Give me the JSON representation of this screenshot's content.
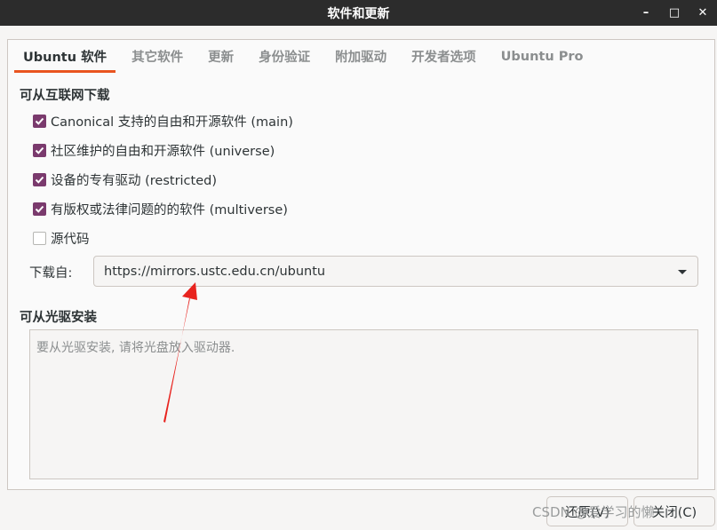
{
  "window": {
    "title": "软件和更新",
    "minimize_glyph": "–",
    "maximize_glyph": "□",
    "close_glyph": "✕"
  },
  "tabs": [
    {
      "label": "Ubuntu 软件",
      "active": true
    },
    {
      "label": "其它软件",
      "active": false
    },
    {
      "label": "更新",
      "active": false
    },
    {
      "label": "身份验证",
      "active": false
    },
    {
      "label": "附加驱动",
      "active": false
    },
    {
      "label": "开发者选项",
      "active": false
    },
    {
      "label": "Ubuntu Pro",
      "active": false
    }
  ],
  "internet": {
    "title": "可从互联网下载",
    "options": [
      {
        "label": "Canonical 支持的自由和开源软件 (main)",
        "checked": true
      },
      {
        "label": "社区维护的自由和开源软件 (universe)",
        "checked": true
      },
      {
        "label": "设备的专有驱动 (restricted)",
        "checked": true
      },
      {
        "label": "有版权或法律问题的的软件 (multiverse)",
        "checked": true
      },
      {
        "label": "源代码",
        "checked": false
      }
    ],
    "download_label": "下载自:",
    "download_server": "https://mirrors.ustc.edu.cn/ubuntu"
  },
  "cdrom": {
    "title": "可从光驱安装",
    "hint": "要从光驱安装, 请将光盘放入驱动器."
  },
  "buttons": {
    "revert_label": "还原(V)",
    "close_label": "关闭(C)"
  },
  "watermark": "CSDN @爱学习的懒",
  "colors": {
    "accent": "#e95420",
    "checkbox": "#7a3a6d",
    "annotation_arrow": "#e8231e"
  }
}
